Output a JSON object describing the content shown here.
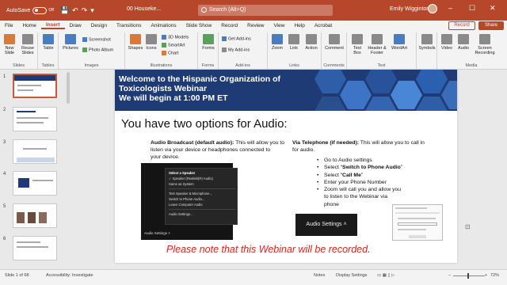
{
  "titlebar": {
    "autosave_label": "AutoSave",
    "autosave_state": "Off",
    "doc_name": "00 Houseke...",
    "search_placeholder": "Search (Alt+Q)",
    "user_name": "Emily Wigginton",
    "accent_color": "#b7472a"
  },
  "menu": {
    "tabs": [
      "File",
      "Home",
      "Insert",
      "Draw",
      "Design",
      "Transitions",
      "Animations",
      "Slide Show",
      "Record",
      "Review",
      "View",
      "Help",
      "Acrobat"
    ],
    "active_tab": "Insert",
    "record_label": "Record",
    "share_label": "Share"
  },
  "ribbon": {
    "new_slide": "New Slide",
    "reuse_slides": "Reuse Slides",
    "table": "Table",
    "pictures": "Pictures",
    "screenshot": "Screenshot",
    "photo_album": "Photo Album",
    "shapes": "Shapes",
    "icons": "Icons",
    "models_3d": "3D Models",
    "smartart": "SmartArt",
    "chart": "Chart",
    "forms": "Forms",
    "get_addins": "Get Add-ins",
    "my_addins": "My Add-ins",
    "zoom": "Zoom",
    "link": "Link",
    "action": "Action",
    "comment": "Comment",
    "text_box": "Text Box",
    "header_footer": "Header & Footer",
    "wordart": "WordArt",
    "symbols": "Symbols",
    "video": "Video",
    "audio": "Audio",
    "screen_recording": "Screen Recording",
    "groups": {
      "slides": "Slides",
      "tables": "Tables",
      "images": "Images",
      "illustrations": "Illustrations",
      "forms": "Forms",
      "addins": "Add-ins",
      "links": "Links",
      "comments": "Comments",
      "text": "Text",
      "media": "Media"
    }
  },
  "thumbnails": {
    "numbers": [
      "1",
      "2",
      "3",
      "4",
      "5",
      "6"
    ]
  },
  "slide": {
    "banner_title_line1": "Welcome to the Hispanic Organization of",
    "banner_title_line2": "Toxicologists Webinar",
    "banner_title_line3": "We will begin at 1:00 PM ET",
    "heading": "You have two options for Audio:",
    "left_bold": "Audio Broadcast (default audio):",
    "left_text_1": " This will allow you to",
    "left_text_2": "listen via your device or headphones connected to",
    "left_text_3": "your device.",
    "right_bold": "Via Telephone (if needed):",
    "right_text_1": " This will allow you to call in",
    "right_text_2": "for audio.",
    "bullet_1": "Go to Audio settings",
    "bullet_2_pre": "Select “",
    "bullet_2_bold": "Switch to Phone Audio",
    "bullet_2_post": "”",
    "bullet_3_pre": "Select “",
    "bullet_3_bold": "Call Me",
    "bullet_3_post": "”",
    "bullet_4": "Enter your Phone Number",
    "bullet_5": "Zoom will call you and allow you",
    "bullet_5_cont1": "to listen to the Webinar via",
    "bullet_5_cont2": "phone",
    "menu_header": "Select a Speaker",
    "menu_item_1": "✓ Speaker (Realtek(R) Audio)",
    "menu_item_2": "Same as System",
    "menu_item_3": "Test Speaker & Microphone...",
    "menu_item_4": "Switch to Phone Audio...",
    "menu_item_5": "Leave Computer Audio",
    "menu_item_6": "Audio Settings...",
    "audio_settings_small": "Audio Settings  ˄",
    "audio_settings_big": "Audio Settings  ˄",
    "notice": "Please note that this Webinar will be recorded.",
    "notice_color": "#d9231c"
  },
  "status": {
    "slide_count": "Slide 1 of 68",
    "accessibility": "Accessibility: Investigate",
    "notes": "Notes",
    "display_settings": "Display Settings",
    "zoom": "72%"
  }
}
